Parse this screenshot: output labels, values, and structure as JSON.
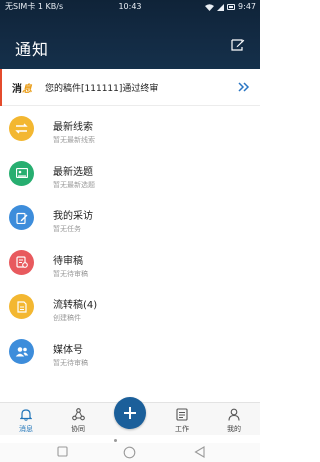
{
  "status_bar": {
    "carrier": "无SIM卡",
    "speed": "1 KB/s",
    "time": "10:43",
    "battery": "9:47"
  },
  "header": {
    "title": "通知"
  },
  "notice": {
    "tag_part1": "消",
    "tag_part2": "息",
    "text": "您的稿件[111111]通过终审"
  },
  "items": [
    {
      "title": "最新线索",
      "subtitle": "暂无最新线索",
      "color": "#f3b731"
    },
    {
      "title": "最新选题",
      "subtitle": "暂无最新选题",
      "color": "#27ae70"
    },
    {
      "title": "我的采访",
      "subtitle": "暂无任务",
      "color": "#3d8ddb"
    },
    {
      "title": "待审稿",
      "subtitle": "暂无待审稿",
      "color": "#e85a5e"
    },
    {
      "title": "流转稿(4)",
      "subtitle": "创建稿件",
      "color": "#f3b731"
    },
    {
      "title": "媒体号",
      "subtitle": "暂无待审稿",
      "color": "#3d8ddb"
    }
  ],
  "bottom_nav": {
    "tabs": [
      {
        "label": "消息",
        "icon": "bell-icon",
        "active": true
      },
      {
        "label": "协同",
        "icon": "share-icon",
        "active": false
      },
      {
        "label": "工作",
        "icon": "document-icon",
        "active": false
      },
      {
        "label": "我的",
        "icon": "person-icon",
        "active": false
      }
    ],
    "accent": "#1d73b8",
    "fab_color": "#1b5f9a"
  }
}
